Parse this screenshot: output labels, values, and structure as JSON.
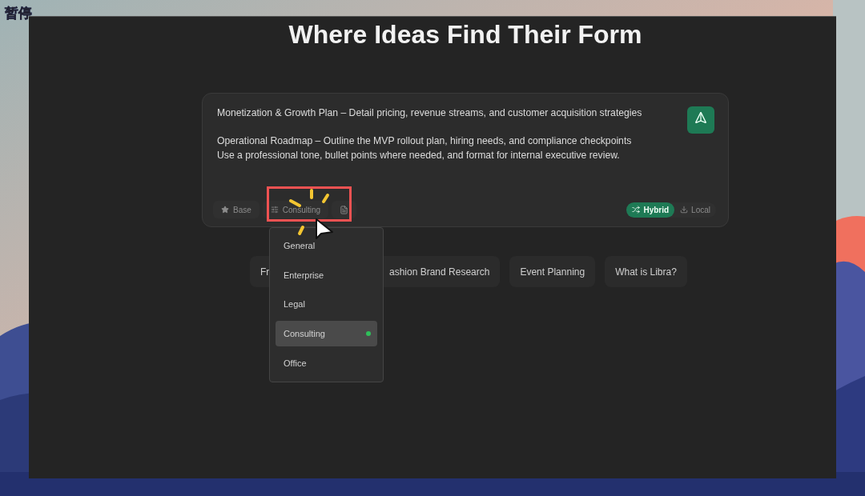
{
  "overlay_label": "暂停",
  "title": "Where Ideas Find Their Form",
  "prompt": {
    "paragraphs": [
      [
        "Monetization & Growth Plan – Detail pricing, revenue streams, and customer acquisition strategies"
      ],
      [
        "Operational Roadmap – Outline the MVP rollout plan, hiring needs, and compliance checkpoints",
        "Use a professional tone, bullet points where needed, and format for internal executive review."
      ]
    ]
  },
  "toolbar": [
    {
      "kind": "star",
      "label": "Base"
    },
    {
      "kind": "sliders",
      "label": "Consulting"
    },
    {
      "kind": "file"
    }
  ],
  "modes": [
    {
      "kind": "shuffle",
      "label": "Hybrid",
      "selected": true
    },
    {
      "kind": "download",
      "label": "Local",
      "selected": false
    }
  ],
  "dropdown": {
    "items": [
      {
        "label": "General",
        "selected": false
      },
      {
        "label": "Enterprise",
        "selected": false
      },
      {
        "label": "Legal",
        "selected": false
      },
      {
        "label": "Consulting",
        "selected": true
      },
      {
        "label": "Office",
        "selected": false
      }
    ]
  },
  "suggestions": [
    "Fr",
    "ashion Brand Research",
    "Event Planning",
    "What is Libra?"
  ]
}
